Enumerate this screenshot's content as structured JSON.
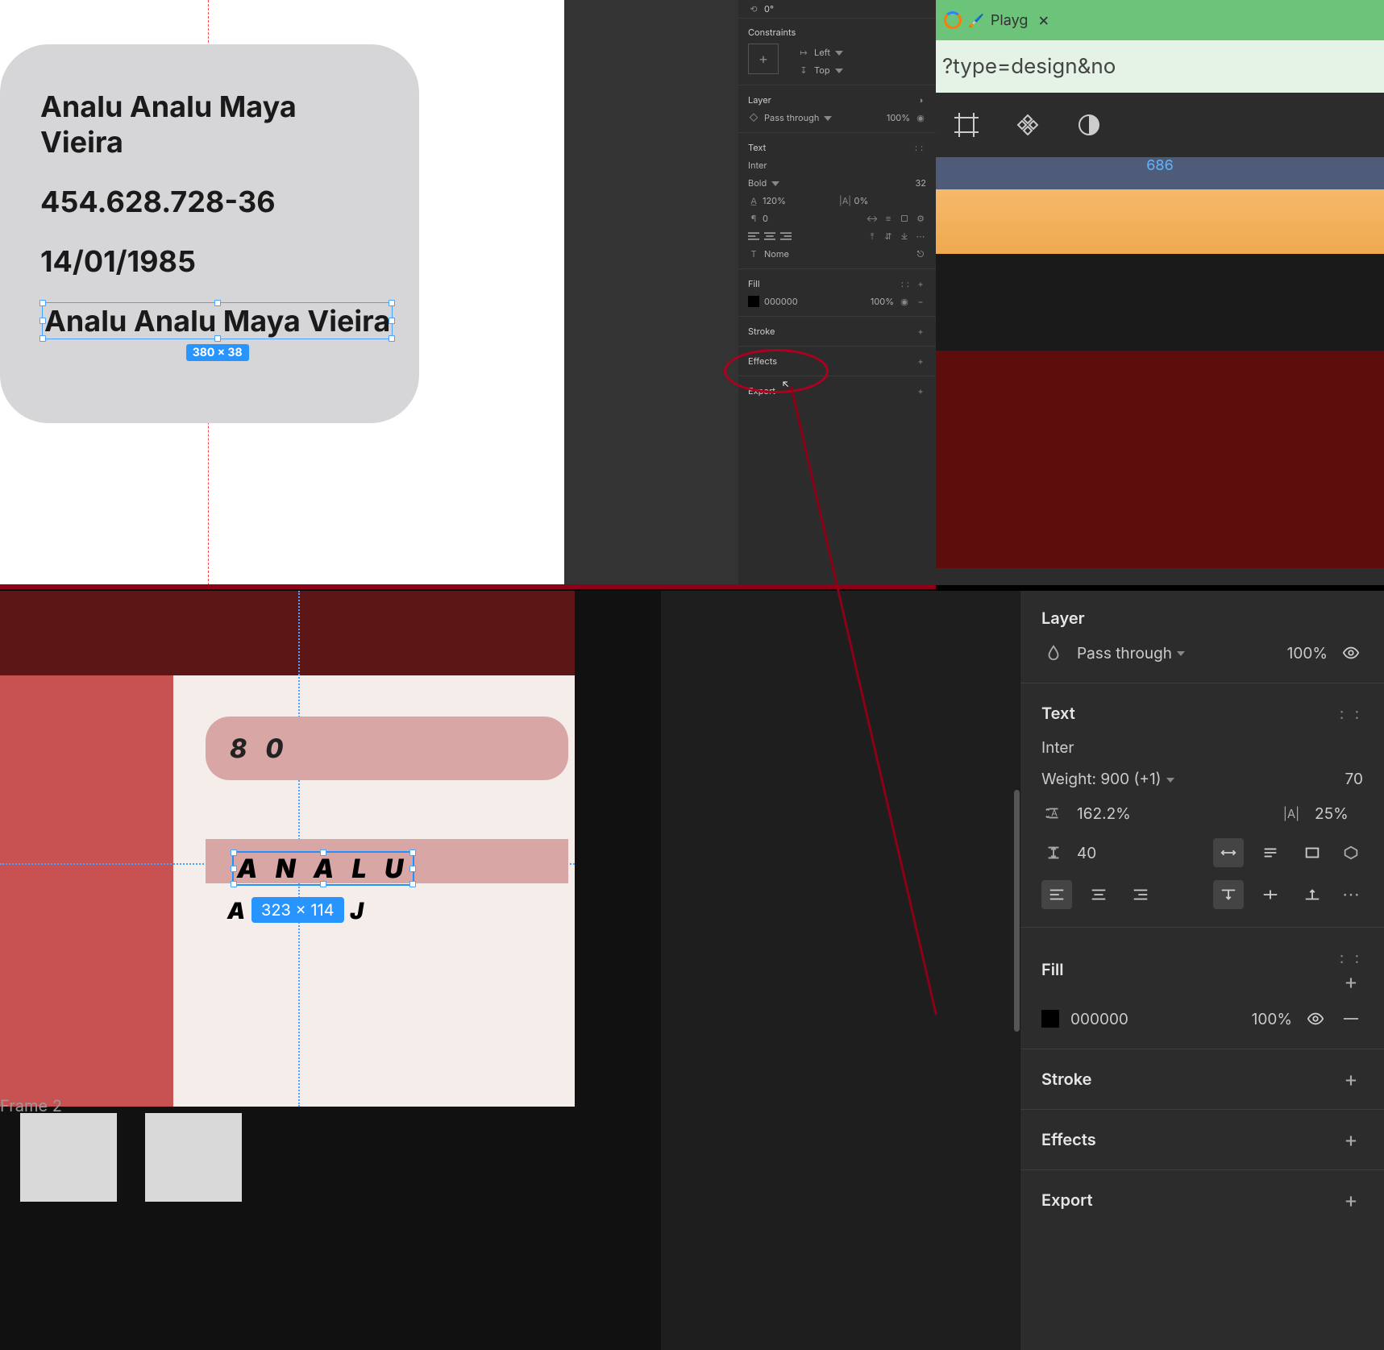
{
  "canvas_top": {
    "card": {
      "name": "Analu Analu Maya Vieira",
      "cpf": "454.628.728-36",
      "dob": "14/01/1985",
      "selected_text": "Analu Analu Maya Vieira",
      "selection_dims": "380 × 38"
    }
  },
  "panel_top": {
    "rotation": "0°",
    "constraints_label": "Constraints",
    "constraint_h": "Left",
    "constraint_v": "Top",
    "layer_label": "Layer",
    "blend_mode": "Pass through",
    "layer_opacity": "100%",
    "text_label": "Text",
    "font_family": "Inter",
    "font_weight": "Bold",
    "font_size": "32",
    "line_height": "120%",
    "letter_spacing": "0%",
    "paragraph_spacing": "0",
    "layer_name": "Nome",
    "fill_label": "Fill",
    "fill_color": "000000",
    "fill_opacity": "100%",
    "stroke_label": "Stroke",
    "effects_label": "Effects",
    "export_label": "Export"
  },
  "browser": {
    "tab_title": "Playg",
    "url_fragment": "?type=design&no",
    "ruler_value": "686"
  },
  "canvas_bot": {
    "frame_label": "Frame 2",
    "pill1_text": "8 0",
    "selected_text": "A N A L U",
    "below_text_left": "A",
    "below_text_right": "J",
    "selection_dims": "323 × 114"
  },
  "panel_bot": {
    "layer_label": "Layer",
    "blend_mode": "Pass through",
    "layer_opacity": "100%",
    "text_label": "Text",
    "font_family": "Inter",
    "font_weight": "Weight: 900 (+1)",
    "font_size": "70",
    "line_height": "162.2%",
    "letter_spacing": "25%",
    "paragraph_spacing": "40",
    "fill_label": "Fill",
    "fill_color": "000000",
    "fill_opacity": "100%",
    "stroke_label": "Stroke",
    "effects_label": "Effects",
    "export_label": "Export"
  }
}
